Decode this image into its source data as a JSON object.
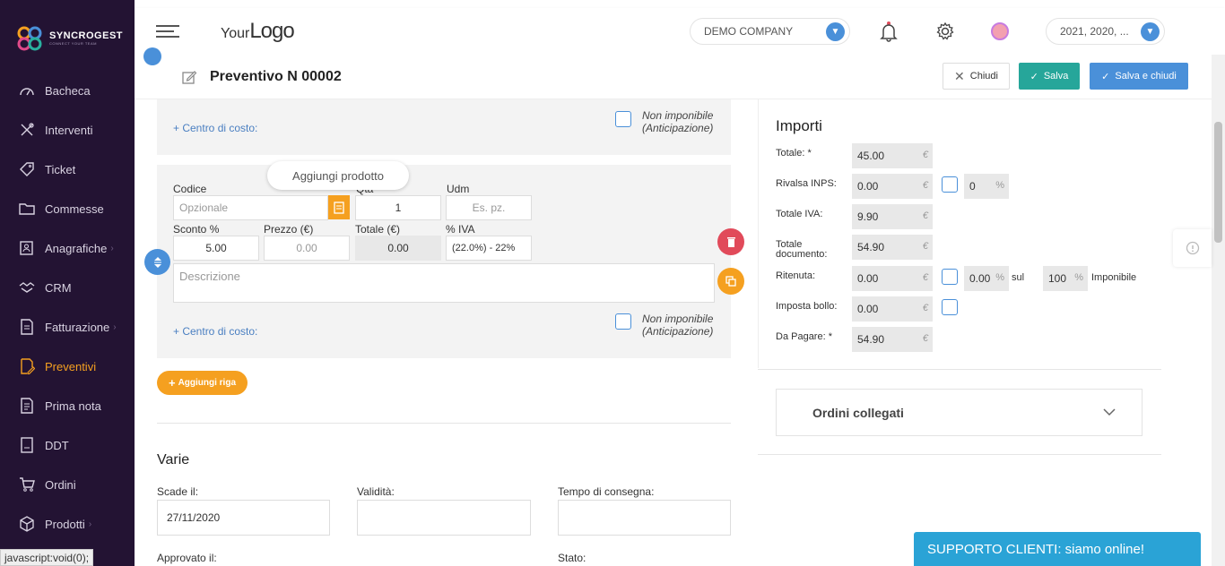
{
  "brand": {
    "name": "SYNCROGEST",
    "tagline": "CONNECT YOUR TEAM"
  },
  "sidebar": {
    "items": [
      {
        "label": "Bacheca",
        "icon": "dashboard-icon",
        "chevron": false
      },
      {
        "label": "Interventi",
        "icon": "tools-icon",
        "chevron": false
      },
      {
        "label": "Ticket",
        "icon": "tag-icon",
        "chevron": false
      },
      {
        "label": "Commesse",
        "icon": "folder-icon",
        "chevron": false
      },
      {
        "label": "Anagrafiche",
        "icon": "contacts-icon",
        "chevron": true
      },
      {
        "label": "CRM",
        "icon": "handshake-icon",
        "chevron": false
      },
      {
        "label": "Fatturazione",
        "icon": "invoice-icon",
        "chevron": true
      },
      {
        "label": "Preventivi",
        "icon": "quote-icon",
        "chevron": false,
        "active": true
      },
      {
        "label": "Prima nota",
        "icon": "note-icon",
        "chevron": false
      },
      {
        "label": "DDT",
        "icon": "ddt-icon",
        "chevron": false
      },
      {
        "label": "Ordini",
        "icon": "cart-icon",
        "chevron": false
      },
      {
        "label": "Prodotti",
        "icon": "box-icon",
        "chevron": true
      }
    ],
    "chevron": "›"
  },
  "topbar": {
    "logo_small": "Your",
    "logo_big": "Logo",
    "company": "DEMO COMPANY",
    "years": "2021, 2020, ..."
  },
  "header": {
    "title": "Preventivo N 00002",
    "close_label": "Chiudi",
    "save_label": "Salva",
    "save_close_label": "Salva e chiudi"
  },
  "row1": {
    "cost_center": "+ Centro di costo:",
    "non_imponibile": "Non imponibile (Anticipazione)"
  },
  "row2": {
    "tooltip": "Aggiungi prodotto",
    "codice_label": "Codice",
    "codice_placeholder": "Opzionale",
    "qta_label": "Qta",
    "qta_value": "1",
    "udm_label": "Udm",
    "udm_placeholder": "Es. pz.",
    "sconto_label": "Sconto %",
    "sconto_value": "5.00",
    "prezzo_label": "Prezzo (€)",
    "prezzo_placeholder": "0.00",
    "totale_label": "Totale (€)",
    "totale_value": "0.00",
    "iva_label": "% IVA",
    "iva_value": "(22.0%) - 22%",
    "descrizione_placeholder": "Descrizione",
    "cost_center": "+ Centro di costo:",
    "non_imponibile": "Non imponibile (Anticipazione)"
  },
  "add_row_label": "Aggiungi riga",
  "varie": {
    "title": "Varie",
    "scade_label": "Scade il:",
    "scade_value": "27/11/2020",
    "validita_label": "Validità:",
    "tempo_label": "Tempo di consegna:",
    "approvato_label": "Approvato il:",
    "stato_label": "Stato:"
  },
  "importi": {
    "title": "Importi",
    "currency": "€",
    "totale_label": "Totale: *",
    "totale_value": "45.00",
    "rivalsa_label": "Rivalsa INPS:",
    "rivalsa_value": "0.00",
    "rivalsa_pct": "0",
    "totale_iva_label": "Totale IVA:",
    "totale_iva_value": "9.90",
    "totale_doc_label": "Totale documento:",
    "totale_doc_value": "54.90",
    "ritenuta_label": "Ritenuta:",
    "ritenuta_value": "0.00",
    "ritenuta_pct": "0.00",
    "sul_label": "sul",
    "imponibile_pct": "100",
    "imponibile_label": "Imponibile",
    "bollo_label": "Imposta bollo:",
    "bollo_value": "0.00",
    "pagare_label": "Da Pagare: *",
    "pagare_value": "54.90",
    "pct_sign": "%"
  },
  "ordini_label": "Ordini collegati",
  "support_label": "SUPPORTO CLIENTI: siamo online!",
  "status_bar": "javascript:void(0);",
  "colors": {
    "sidebar": "#231333",
    "accent": "#f5a020",
    "primary": "#4a90d9",
    "success": "#26a69a",
    "danger": "#e14a5a",
    "support": "#2aa3d6"
  }
}
